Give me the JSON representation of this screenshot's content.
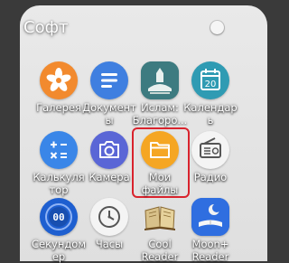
{
  "folder": {
    "title": "Софт"
  },
  "apps": [
    {
      "label": "Галерея",
      "icon": "gallery-icon"
    },
    {
      "label": "Документ\nы",
      "icon": "documents-icon"
    },
    {
      "label": "Ислам:\nБлагоро...",
      "icon": "islam-app-icon"
    },
    {
      "label": "Календар\nь",
      "icon": "calendar-icon",
      "day": "20"
    },
    {
      "label": "Калькуля\nтор",
      "icon": "calculator-icon"
    },
    {
      "label": "Камера",
      "icon": "camera-icon"
    },
    {
      "label": "Мои\nфайлы",
      "icon": "my-files-icon"
    },
    {
      "label": "Радио",
      "icon": "radio-icon"
    },
    {
      "label": "Секундом\nер",
      "icon": "stopwatch-icon",
      "digits": "00"
    },
    {
      "label": "Часы",
      "icon": "clock-icon"
    },
    {
      "label": "Cool\nReader",
      "icon": "cool-reader-icon"
    },
    {
      "label": "Moon+\nReader",
      "icon": "moon-reader-icon"
    }
  ],
  "colors": {
    "folder_bg": "#e6e6e6",
    "highlight": "#d9232d",
    "gallery": "#f28a2e",
    "documents": "#3f7fe0",
    "calendar": "#2f9bb3",
    "calculator": "#3a86e8",
    "camera": "#5a66d6",
    "my_files": "#f5a623",
    "stopwatch": "#1e5fd0"
  }
}
